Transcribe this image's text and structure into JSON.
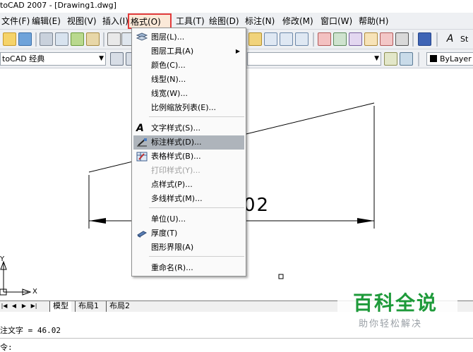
{
  "window": {
    "title": "toCAD 2007 - [Drawing1.dwg]"
  },
  "menubar": {
    "items": [
      {
        "label": "文件(F)"
      },
      {
        "label": "编辑(E)"
      },
      {
        "label": "视图(V)"
      },
      {
        "label": "插入(I)"
      },
      {
        "label": "格式(O)"
      },
      {
        "label": "工具(T)"
      },
      {
        "label": "绘图(D)"
      },
      {
        "label": "标注(N)"
      },
      {
        "label": "修改(M)"
      },
      {
        "label": "窗口(W)"
      },
      {
        "label": "帮助(H)"
      }
    ],
    "active_index": 4,
    "highlight_color": "#e23b3b"
  },
  "toolbar2": {
    "workspace": "toCAD 经典",
    "layer_value": "ByLayer",
    "style_text_partial": "St"
  },
  "format_menu": {
    "items": [
      {
        "label": "图层(L)...",
        "icon": "layers-icon"
      },
      {
        "label": "图层工具(A)",
        "submenu": true
      },
      {
        "label": "颜色(C)..."
      },
      {
        "label": "线型(N)..."
      },
      {
        "label": "线宽(W)..."
      },
      {
        "label": "比例缩放列表(E)..."
      },
      {
        "label": "文字样式(S)...",
        "icon": "text-style-icon"
      },
      {
        "label": "标注样式(D)...",
        "icon": "dimension-style-icon",
        "highlighted": true
      },
      {
        "label": "表格样式(B)...",
        "icon": "table-style-icon"
      },
      {
        "label": "打印样式(Y)...",
        "disabled": true
      },
      {
        "label": "点样式(P)..."
      },
      {
        "label": "多线样式(M)..."
      },
      {
        "label": "单位(U)..."
      },
      {
        "label": "厚度(T)",
        "icon": "thickness-icon"
      },
      {
        "label": "图形界限(A)"
      },
      {
        "label": "重命名(R)..."
      }
    ]
  },
  "drawing": {
    "dimension_text": "02",
    "ucs_x": "X",
    "ucs_y": "Y",
    "annotation_arrow_color": "#e23b3b"
  },
  "tabs": {
    "items": [
      {
        "label": "模型"
      },
      {
        "label": "布局1"
      },
      {
        "label": "布局2"
      }
    ],
    "active_index": 0
  },
  "command": {
    "line1": "注文字 = 46.02",
    "line2": "令:"
  },
  "watermark": {
    "title": "百科全说",
    "subtitle": "助你轻松解决",
    "color": "#1e9a3a"
  }
}
